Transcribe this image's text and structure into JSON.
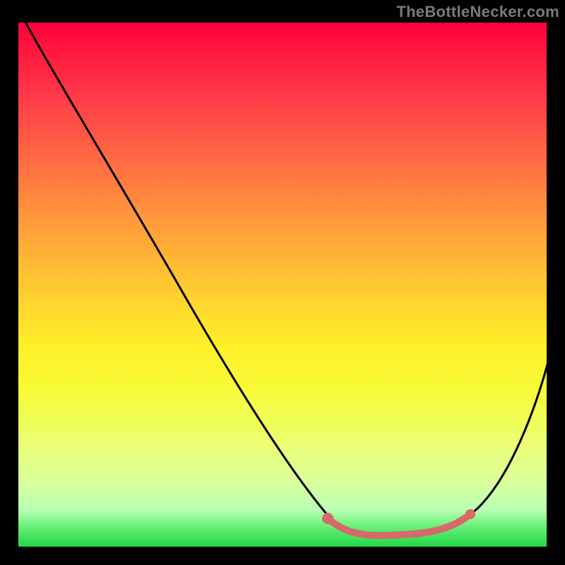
{
  "attribution": "TheBottleNecker.com",
  "chart_data": {
    "type": "line",
    "title": "",
    "xlabel": "",
    "ylabel": "",
    "xlim": [
      0,
      100
    ],
    "ylim": [
      0,
      100
    ],
    "series": [
      {
        "name": "bottleneck-curve",
        "x": [
          0,
          10,
          20,
          30,
          40,
          50,
          58,
          66,
          72,
          78,
          84,
          88,
          92,
          96,
          100
        ],
        "y": [
          2,
          16,
          30,
          44,
          58,
          72,
          84,
          93,
          97,
          98,
          97,
          93,
          85,
          73,
          58
        ]
      }
    ],
    "valley_marker": {
      "color": "#d66a68",
      "x_start": 58,
      "x_end": 84,
      "y": 96
    },
    "gradient_stops": [
      {
        "pos": 0,
        "color": "#ff003c"
      },
      {
        "pos": 50,
        "color": "#ffd028"
      },
      {
        "pos": 100,
        "color": "#20d848"
      }
    ]
  }
}
